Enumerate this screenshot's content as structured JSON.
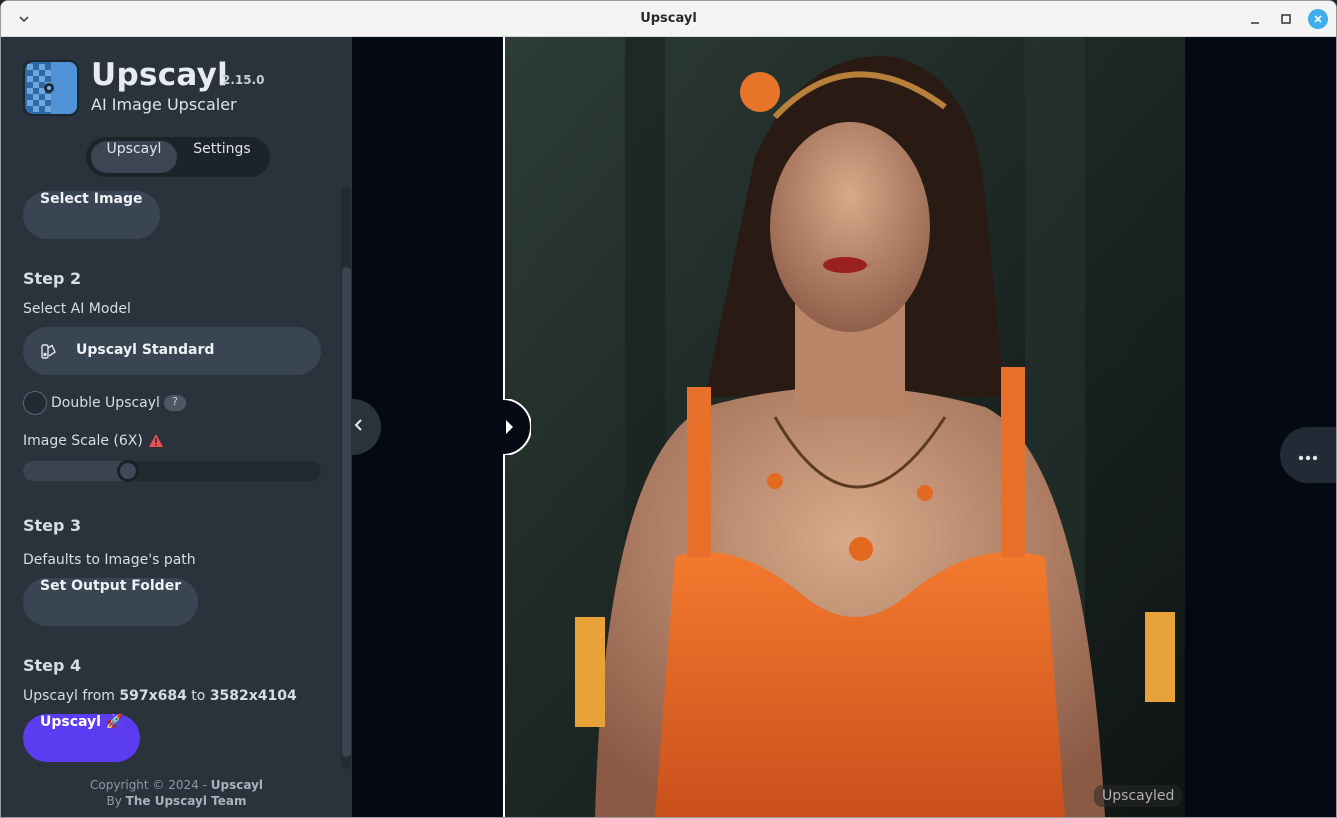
{
  "window": {
    "title": "Upscayl"
  },
  "sidebar": {
    "app_name": "Upscayl",
    "version": "2.15.0",
    "subtitle": "AI Image Upscaler",
    "tabs": [
      {
        "label": "Upscayl",
        "active": true
      },
      {
        "label": "Settings",
        "active": false
      }
    ],
    "select_image_label": "Select Image",
    "step2": {
      "title": "Step 2",
      "model_label": "Select AI Model",
      "model_value": "Upscayl Standard",
      "double_upscayl_label": "Double Upscayl",
      "double_upscayl_checked": false,
      "help_label": "?",
      "scale_label": "Image Scale (6X)",
      "scale_fraction": 0.34
    },
    "step3": {
      "title": "Step 3",
      "text": "Defaults to Image's path",
      "button_label": "Set Output Folder"
    },
    "step4": {
      "title": "Step 4",
      "text_prefix": "Upscayl from ",
      "from_size": "597x684",
      "text_mid": " to ",
      "to_size": "3582x4104",
      "button_label": "Upscayl 🚀"
    },
    "copyright": {
      "line1_prefix": "Copyright © 2024 - ",
      "line1_brand": "Upscayl",
      "line2_prefix": "By ",
      "line2_team": "The Upscayl Team"
    }
  },
  "viewer": {
    "result_tag": "Upscayled"
  },
  "colors": {
    "accent": "#5b3cf0",
    "sidebar_bg": "#2a323c",
    "main_bg": "#040914",
    "warning": "#f05050",
    "titlebar_close": "#3daee9"
  },
  "icons": {
    "collapse": "chevron-left-icon",
    "divider_handle": "play-icon",
    "more": "ellipsis-icon",
    "model": "model-icon",
    "warning": "warning-icon"
  }
}
